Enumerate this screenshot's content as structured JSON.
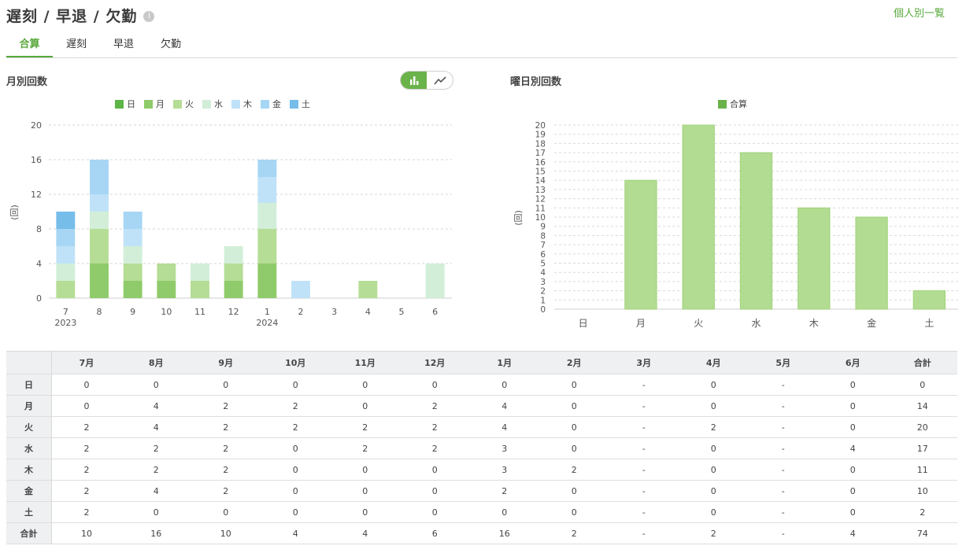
{
  "header": {
    "title": "遅刻 / 早退 / 欠勤",
    "link": "個人別一覧"
  },
  "tabs": [
    {
      "label": "合算"
    },
    {
      "label": "遅刻"
    },
    {
      "label": "早退"
    },
    {
      "label": "欠勤"
    }
  ],
  "colors": {
    "accent": "#57a83a",
    "series": [
      "#5db548",
      "#8fcb6a",
      "#b5dd95",
      "#d2eed8",
      "#bfe2f8",
      "#a6d6f4",
      "#76bdea"
    ]
  },
  "chart_data": [
    {
      "type": "bar",
      "stacked": true,
      "title": "月別回数",
      "ylabel": "(回)",
      "xlabel": "",
      "categories": [
        "7\n2023",
        "8",
        "9",
        "10",
        "11",
        "12",
        "1\n2024",
        "2",
        "3",
        "4",
        "5",
        "6"
      ],
      "series": [
        {
          "name": "日",
          "values": [
            0,
            0,
            0,
            0,
            0,
            0,
            0,
            0,
            0,
            0,
            0,
            0
          ]
        },
        {
          "name": "月",
          "values": [
            0,
            4,
            2,
            2,
            0,
            2,
            4,
            0,
            0,
            0,
            0,
            0
          ]
        },
        {
          "name": "火",
          "values": [
            2,
            4,
            2,
            2,
            2,
            2,
            4,
            0,
            0,
            2,
            0,
            0
          ]
        },
        {
          "name": "水",
          "values": [
            2,
            2,
            2,
            0,
            2,
            2,
            3,
            0,
            0,
            0,
            0,
            4
          ]
        },
        {
          "name": "木",
          "values": [
            2,
            2,
            2,
            0,
            0,
            0,
            3,
            2,
            0,
            0,
            0,
            0
          ]
        },
        {
          "name": "金",
          "values": [
            2,
            4,
            2,
            0,
            0,
            0,
            2,
            0,
            0,
            0,
            0,
            0
          ]
        },
        {
          "name": "土",
          "values": [
            2,
            0,
            0,
            0,
            0,
            0,
            0,
            0,
            0,
            0,
            0,
            0
          ]
        }
      ],
      "ylim": [
        0,
        20
      ],
      "yticks": [
        0,
        4,
        8,
        12,
        16,
        20
      ],
      "grid": true,
      "legend": "top-center"
    },
    {
      "type": "bar",
      "title": "曜日別回数",
      "ylabel": "(回)",
      "xlabel": "",
      "categories": [
        "日",
        "月",
        "火",
        "水",
        "木",
        "金",
        "土"
      ],
      "series": [
        {
          "name": "合算",
          "values": [
            0,
            14,
            20,
            17,
            11,
            10,
            2
          ]
        }
      ],
      "ylim": [
        0,
        20
      ],
      "yticks": [
        0,
        1,
        2,
        3,
        4,
        5,
        6,
        7,
        8,
        9,
        10,
        11,
        12,
        13,
        14,
        15,
        16,
        17,
        18,
        19,
        20
      ],
      "grid": true,
      "legend": "top-center"
    }
  ],
  "table": {
    "columns": [
      "",
      "7月",
      "8月",
      "9月",
      "10月",
      "11月",
      "12月",
      "1月",
      "2月",
      "3月",
      "4月",
      "5月",
      "6月",
      "合計"
    ],
    "rows": [
      {
        "label": "日",
        "cells": [
          "0",
          "0",
          "0",
          "0",
          "0",
          "0",
          "0",
          "0",
          "-",
          "0",
          "-",
          "0",
          "0"
        ]
      },
      {
        "label": "月",
        "cells": [
          "0",
          "4",
          "2",
          "2",
          "0",
          "2",
          "4",
          "0",
          "-",
          "0",
          "-",
          "0",
          "14"
        ]
      },
      {
        "label": "火",
        "cells": [
          "2",
          "4",
          "2",
          "2",
          "2",
          "2",
          "4",
          "0",
          "-",
          "2",
          "-",
          "0",
          "20"
        ]
      },
      {
        "label": "水",
        "cells": [
          "2",
          "2",
          "2",
          "0",
          "2",
          "2",
          "3",
          "0",
          "-",
          "0",
          "-",
          "4",
          "17"
        ]
      },
      {
        "label": "木",
        "cells": [
          "2",
          "2",
          "2",
          "0",
          "0",
          "0",
          "3",
          "2",
          "-",
          "0",
          "-",
          "0",
          "11"
        ]
      },
      {
        "label": "金",
        "cells": [
          "2",
          "4",
          "2",
          "0",
          "0",
          "0",
          "2",
          "0",
          "-",
          "0",
          "-",
          "0",
          "10"
        ]
      },
      {
        "label": "土",
        "cells": [
          "2",
          "0",
          "0",
          "0",
          "0",
          "0",
          "0",
          "0",
          "-",
          "0",
          "-",
          "0",
          "2"
        ]
      },
      {
        "label": "合計",
        "cells": [
          "10",
          "16",
          "10",
          "4",
          "4",
          "6",
          "16",
          "2",
          "-",
          "2",
          "-",
          "4",
          "74"
        ]
      }
    ]
  }
}
